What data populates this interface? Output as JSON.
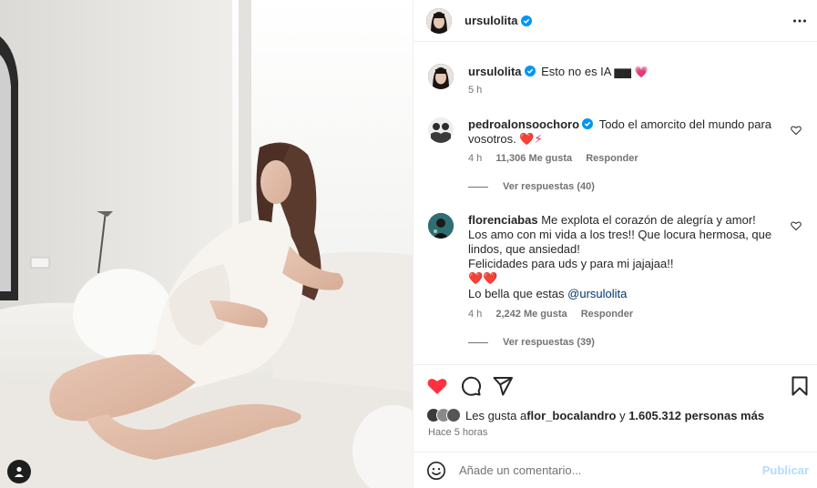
{
  "post": {
    "author": "ursulolita",
    "more_icon": "more-horizontal-icon"
  },
  "caption": {
    "username": "ursulolita",
    "text": "Esto no es IA",
    "emoji": "▆▆ 💗",
    "time": "5 h"
  },
  "comments": [
    {
      "username": "pedroalonsoochoro",
      "verified": true,
      "text": "Todo el amorcito del mundo para vosotros.",
      "emoji": "❤️⚡",
      "time": "4 h",
      "likes": "11,306 Me gusta",
      "reply": "Responder",
      "view_replies": "Ver respuestas (40)"
    },
    {
      "username": "florenciabas",
      "verified": false,
      "text_line1": "Me explota el corazón de alegría y amor! Los amo con mi vida a los tres!! Que locura hermosa, que lindos, que ansiedad!",
      "text_line2": "Felicidades para uds y para mi jajajaa!!",
      "emoji": "❤️❤️",
      "text_line3": "Lo bella que estas ",
      "mention": "@ursulolita",
      "time": "4 h",
      "likes": "2,242 Me gusta",
      "reply": "Responder",
      "view_replies": "Ver respuestas (39)"
    }
  ],
  "likes": {
    "prefix": "Les gusta a ",
    "user": "flor_bocalandro",
    "middle": " y ",
    "count": "1.605.312 personas más"
  },
  "post_time": "Hace 5 horas",
  "composer": {
    "placeholder": "Añade un comentario...",
    "publish": "Publicar"
  },
  "colors": {
    "like_red": "#ff3040",
    "verified_blue": "#0095f6",
    "publish_disabled": "#b3dbff"
  }
}
